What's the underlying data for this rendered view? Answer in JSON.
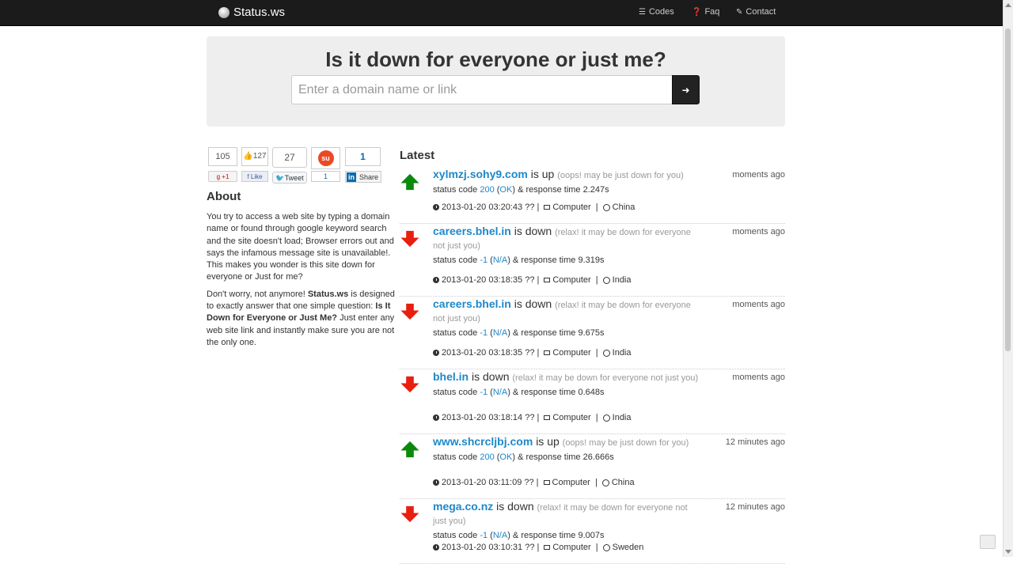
{
  "nav": {
    "brand": "Status.ws",
    "codes": "Codes",
    "faq": "Faq",
    "contact": "Contact"
  },
  "hero": {
    "title": "Is it down for everyone or just me?",
    "placeholder": "Enter a domain name or link"
  },
  "social": {
    "gplus_count": "105",
    "gplus_label": "+1",
    "fb_count": "127",
    "fb_label": "Like",
    "tw_count": "27",
    "tw_label": "Tweet",
    "su_count": "1",
    "li_count": "1",
    "li_label": "Share"
  },
  "about": {
    "title": "About",
    "p1": "You try to access a web site by typing a domain name or found through google keyword search and the site doesn't load; Browser errors out and says the infamous message site is unavailable!. This makes you wonder is this site down for everyone or Just for me?",
    "p2_a": "Don't worry, not anymore! ",
    "p2_b": "Status.ws",
    "p2_c": " is designed to exactly answer that one simple question: ",
    "p2_d": "Is It Down for Everyone or Just Me?",
    "p2_e": " Just enter any web site link and instantly make sure you are not the only one."
  },
  "latest": {
    "title": "Latest",
    "status_prefix": "status code",
    "response_prefix": "& response time",
    "items": [
      {
        "domain": "xylmzj.sohy9.com",
        "verdict": "is up",
        "note": "(oops! may be just down for you)",
        "code": "200",
        "code_label": "OK",
        "time": "2.247s",
        "timestamp": "2013-01-20 03:20:43 ??",
        "device": "Computer",
        "country": "China",
        "ago": "moments ago",
        "up": true
      },
      {
        "domain": "careers.bhel.in",
        "verdict": "is down",
        "note": "(relax! it may be down for everyone not just you)",
        "code": "-1",
        "code_label": "N/A",
        "time": "9.319s",
        "timestamp": "2013-01-20 03:18:35 ??",
        "device": "Computer",
        "country": "India",
        "ago": "moments ago",
        "up": false
      },
      {
        "domain": "careers.bhel.in",
        "verdict": "is down",
        "note": "(relax! it may be down for everyone not just you)",
        "code": "-1",
        "code_label": "N/A",
        "time": "9.675s",
        "timestamp": "2013-01-20 03:18:35 ??",
        "device": "Computer",
        "country": "India",
        "ago": "moments ago",
        "up": false
      },
      {
        "domain": "bhel.in",
        "verdict": "is down",
        "note": "(relax! it may be down for everyone not just you)",
        "code": "-1",
        "code_label": "N/A",
        "time": "0.648s",
        "timestamp": "2013-01-20 03:18:14 ??",
        "device": "Computer",
        "country": "India",
        "ago": "moments ago",
        "up": false
      },
      {
        "domain": "www.shcrcljbj.com",
        "verdict": "is up",
        "note": "(oops! may be just down for you)",
        "code": "200",
        "code_label": "OK",
        "time": "26.666s",
        "timestamp": "2013-01-20 03:11:09 ??",
        "device": "Computer",
        "country": "China",
        "ago": "12 minutes ago",
        "up": true
      },
      {
        "domain": "mega.co.nz",
        "verdict": "is down",
        "note": "(relax! it may be down for everyone not just you)",
        "code": "-1",
        "code_label": "N/A",
        "time": "9.007s",
        "timestamp": "2013-01-20 03:10:31 ??",
        "device": "Computer",
        "country": "Sweden",
        "ago": "12 minutes ago",
        "up": false
      }
    ]
  },
  "colors": {
    "up_arrow": "#0a8a0a",
    "down_arrow": "#e81f0f",
    "link": "#1e88c9",
    "navbar": "#1b1b1b"
  }
}
